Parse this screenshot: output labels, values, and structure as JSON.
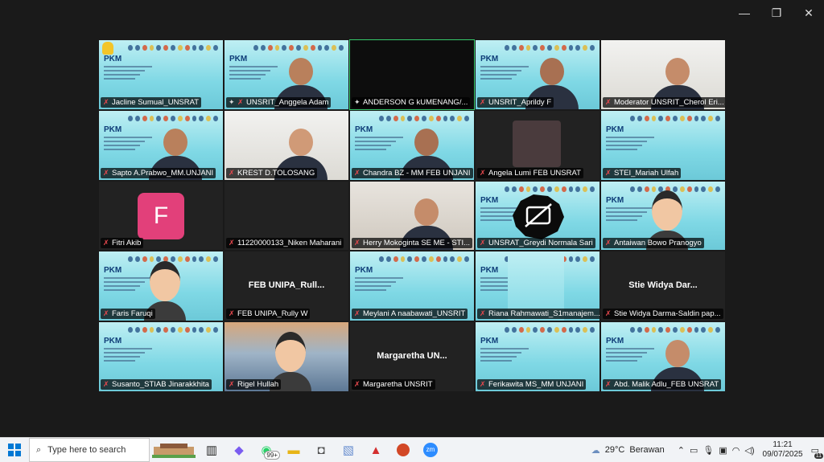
{
  "window": {
    "minimize": "—",
    "restore": "❐",
    "close": "✕"
  },
  "participants": [
    {
      "name": "Jacline Sumual_UNSRAT",
      "type": "slide",
      "muted": true,
      "badge": true
    },
    {
      "name": "UNSRIT_Anggela Adam",
      "type": "slide-person",
      "muted": true,
      "pinned": true
    },
    {
      "name": "ANDERSON G kUMENANG/...",
      "type": "black",
      "muted": false,
      "pinned": true,
      "active": true
    },
    {
      "name": "UNSRIT_Aprildy F",
      "type": "slide-person",
      "muted": true
    },
    {
      "name": "Moderator UNSRIT_Cherol Eri...",
      "type": "photo-wall",
      "muted": true
    },
    {
      "name": "Sapto A.Prabwo_MM.UNJANI",
      "type": "slide-person",
      "muted": true
    },
    {
      "name": "KREST D.TOLOSANG",
      "type": "photo-wall",
      "muted": true
    },
    {
      "name": "Chandra BZ - MM FEB UNJANI",
      "type": "slide-person",
      "muted": true
    },
    {
      "name": "Angela Lumi FEB UNSRAT",
      "type": "dark-photo",
      "muted": true
    },
    {
      "name": "STEI_Mariah Ulfah",
      "type": "slide",
      "muted": true
    },
    {
      "name": "Fitri Akib",
      "type": "avatar",
      "avatar": "F",
      "muted": true
    },
    {
      "name": "11220000133_Niken Maharani",
      "type": "dark",
      "muted": true
    },
    {
      "name": "Herry Mokoginta SE ME - STI...",
      "type": "photo-room",
      "muted": true
    },
    {
      "name": "UNSRAT_Greydi Normala Sari",
      "type": "slide-camoff",
      "muted": true
    },
    {
      "name": "Antaiwan Bowo Pranogyo",
      "type": "slide-cartoon",
      "muted": true
    },
    {
      "name": "Faris Faruqi",
      "type": "slide-cartoon",
      "muted": true
    },
    {
      "name": "FEB UNIPA_Rully W",
      "type": "dark",
      "center": "FEB UNIPA_Rull...",
      "muted": true
    },
    {
      "name": "Meylani A naabawati_UNSRIT",
      "type": "slide",
      "muted": true
    },
    {
      "name": "Riana Rahmawati_S1manajem...",
      "type": "slide-partial",
      "muted": true
    },
    {
      "name": "Stie Widya Darma-Saldin pap...",
      "type": "dark",
      "center": "Stie Widya Dar...",
      "muted": true
    },
    {
      "name": "Susanto_STIAB Jinarakkhita",
      "type": "slide",
      "muted": true
    },
    {
      "name": "Rigel Hullah",
      "type": "photo-sunset",
      "muted": true
    },
    {
      "name": "Margaretha UNSRIT",
      "type": "dark",
      "center": "Margaretha  UN...",
      "muted": true
    },
    {
      "name": "Ferikawita MS_MM UNJANI",
      "type": "slide",
      "muted": true
    },
    {
      "name": "Abd. Malik Adlu_FEB UNSRAT",
      "type": "slide-person",
      "muted": true
    }
  ],
  "slide": {
    "title": "PKM"
  },
  "taskbar": {
    "search_placeholder": "Type here to search",
    "whatsapp_badge": "99+",
    "weather_temp": "29°C",
    "weather_desc": "Berawan",
    "time": "11:21",
    "date": "09/07/2025",
    "notification_count": "11",
    "accent": "#0078d4"
  }
}
